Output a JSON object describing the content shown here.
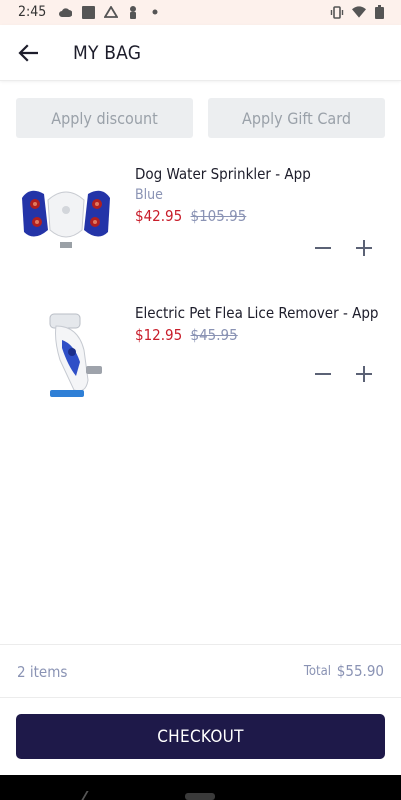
{
  "status_bar": {
    "time": "2:45",
    "icons": [
      "cloud-icon",
      "photo-icon",
      "drive-icon",
      "person-icon",
      "dot-icon",
      "vibrate-icon",
      "wifi-icon",
      "battery-icon"
    ]
  },
  "header": {
    "title": "MY BAG",
    "back_icon": "arrow-left-icon"
  },
  "actions": {
    "discount_label": "Apply discount",
    "giftcard_label": "Apply Gift Card"
  },
  "items": [
    {
      "name": "Dog Water Sprinkler - App",
      "variant": "Blue",
      "price": "$42.95",
      "compare_price": "$105.95"
    },
    {
      "name": "Electric Pet Flea Lice Remover - App",
      "variant": "",
      "price": "$12.95",
      "compare_price": "$45.95"
    }
  ],
  "summary": {
    "items_count": "2 items",
    "total_label": "Total",
    "total_value": "$55.90"
  },
  "checkout": {
    "label": "CHECKOUT"
  },
  "colors": {
    "accent": "#1e1949",
    "sale": "#c81d2a",
    "muted": "#8a93b4",
    "status_bg": "#fdf1ec"
  }
}
